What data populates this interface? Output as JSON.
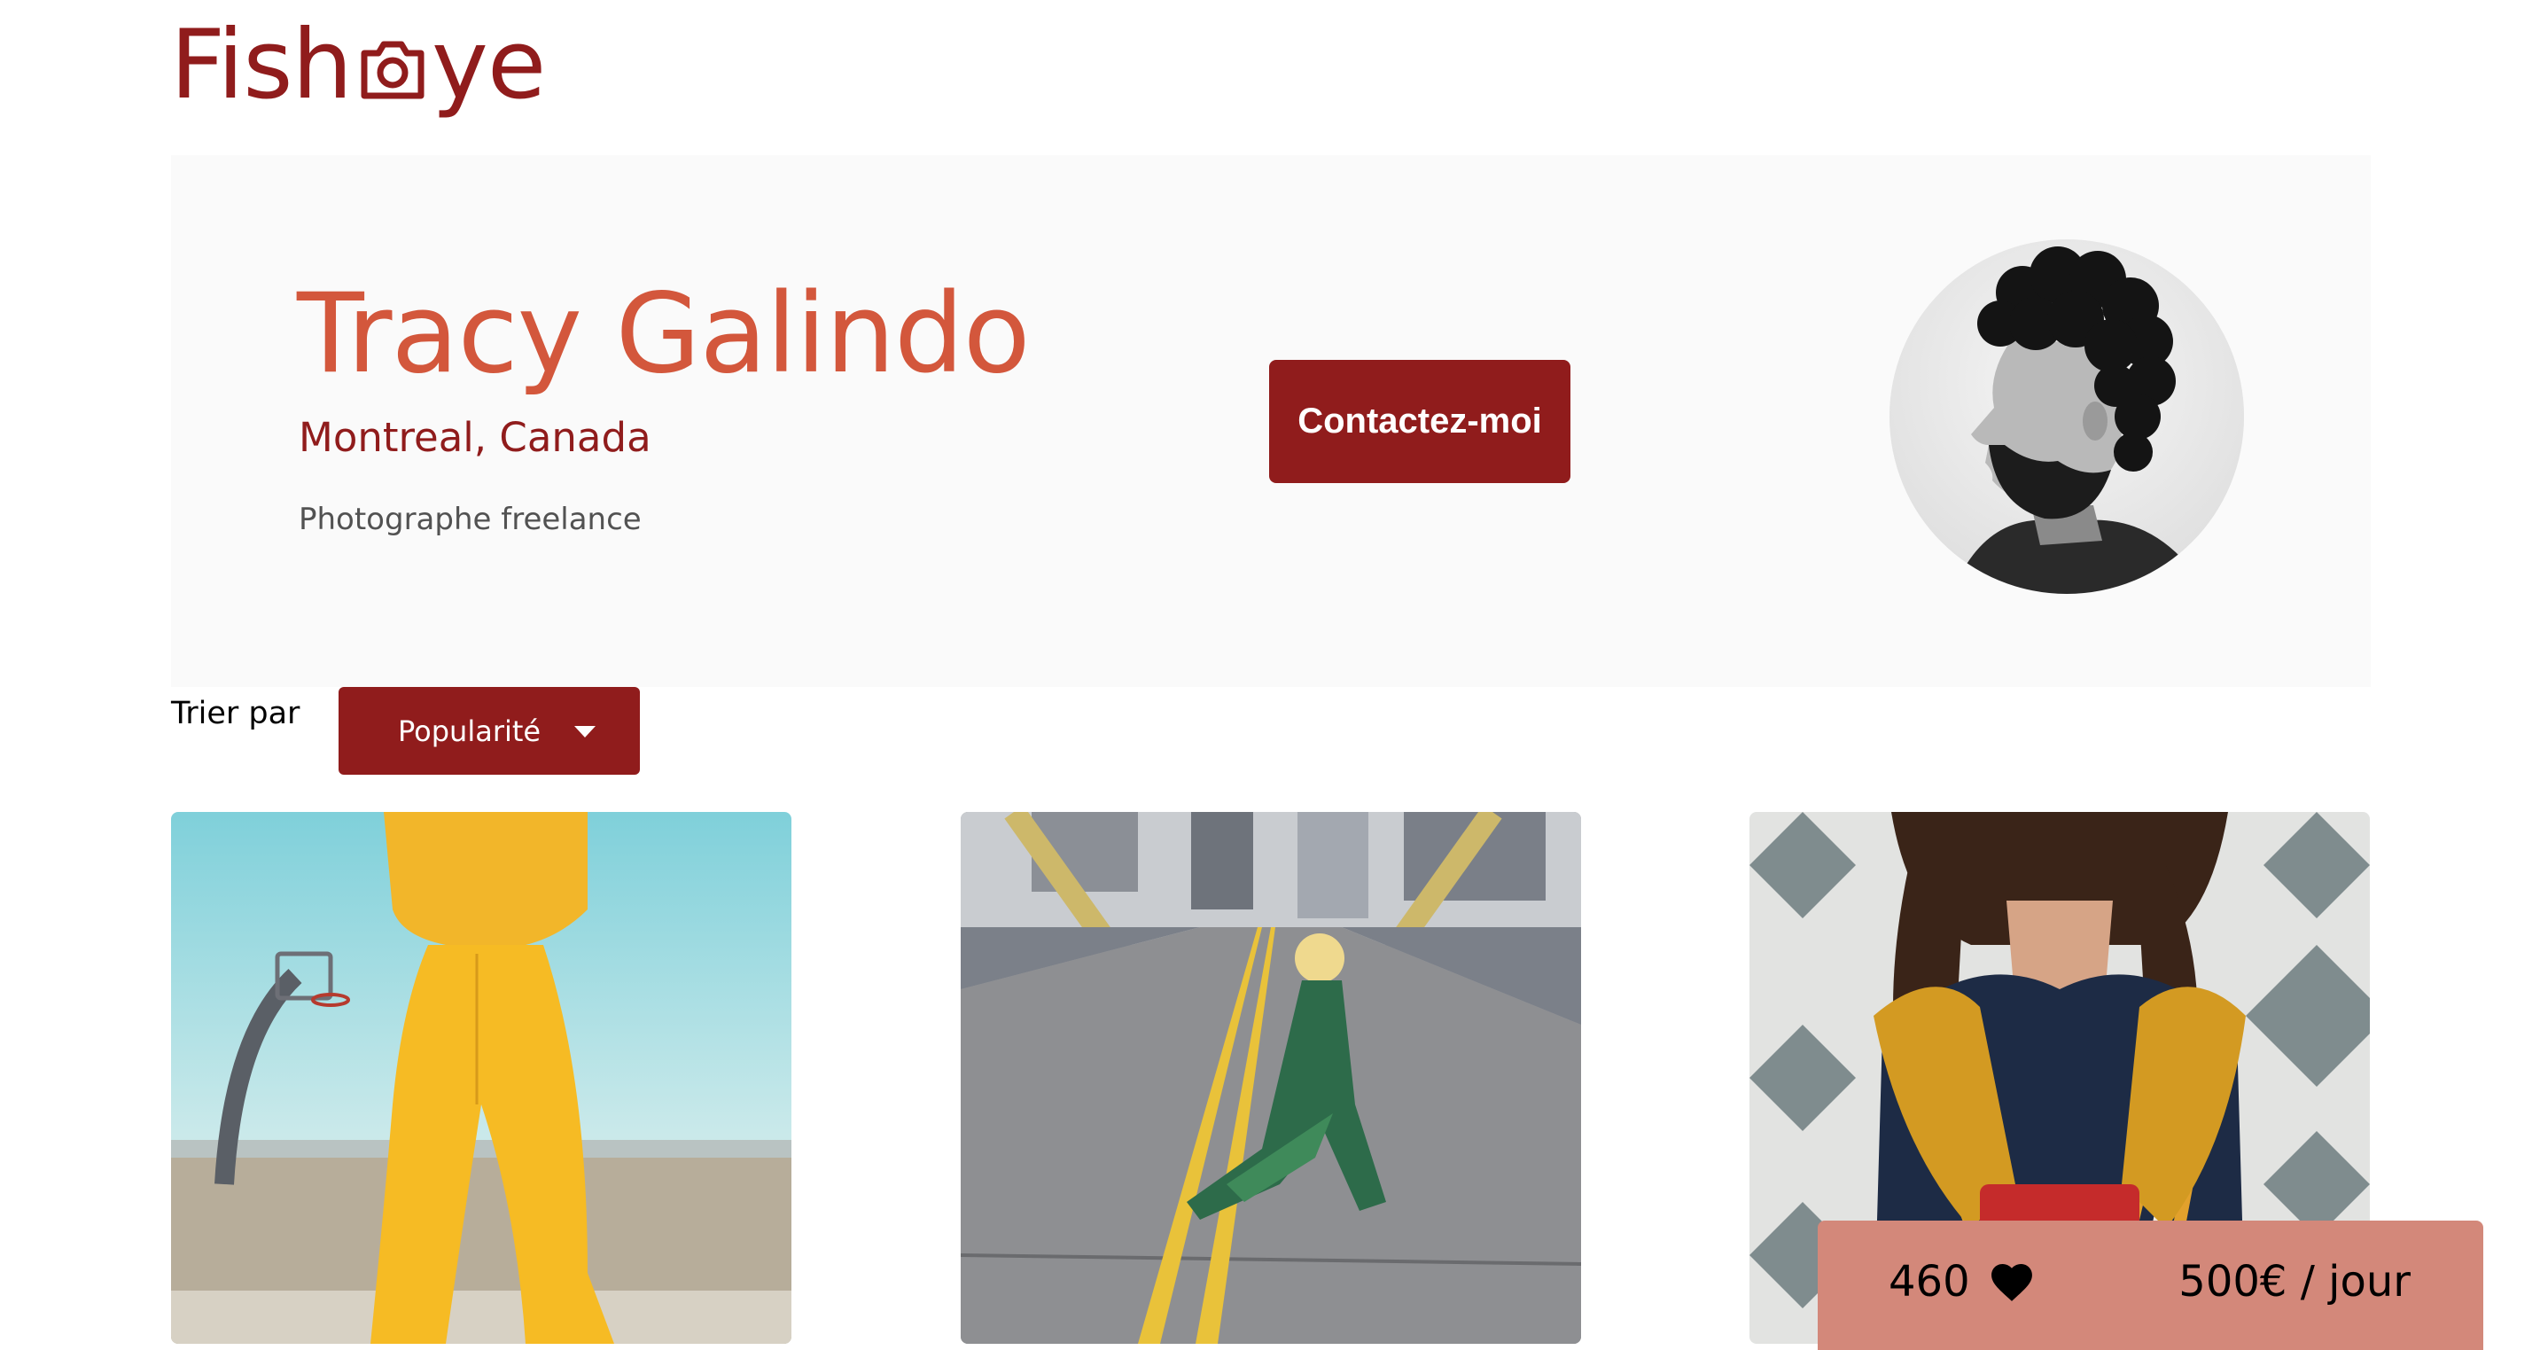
{
  "logo": {
    "text_before": "Fish",
    "text_after": "ye",
    "icon": "camera-icon",
    "color": "#901C1C"
  },
  "photographer": {
    "name": "Tracy Galindo",
    "location": "Montreal, Canada",
    "tagline": "Photographe freelance",
    "contact_label": "Contactez-moi"
  },
  "sort": {
    "label": "Trier par",
    "selected": "Popularité",
    "icon": "chevron-down-icon"
  },
  "gallery": [
    {
      "subject": "yellow tracksuit by basketball hoop"
    },
    {
      "subject": "woman crouching on bridge road"
    },
    {
      "subject": "striped jacket with yellow scarf"
    }
  ],
  "stats": {
    "likes": "460",
    "like_icon": "heart-icon",
    "price": "500€ / jour"
  },
  "colors": {
    "primary": "#901C1C",
    "name": "#D3573C",
    "panel": "#FAFAFA",
    "stats_bg": "#D3887A",
    "text_secondary": "#525252"
  }
}
